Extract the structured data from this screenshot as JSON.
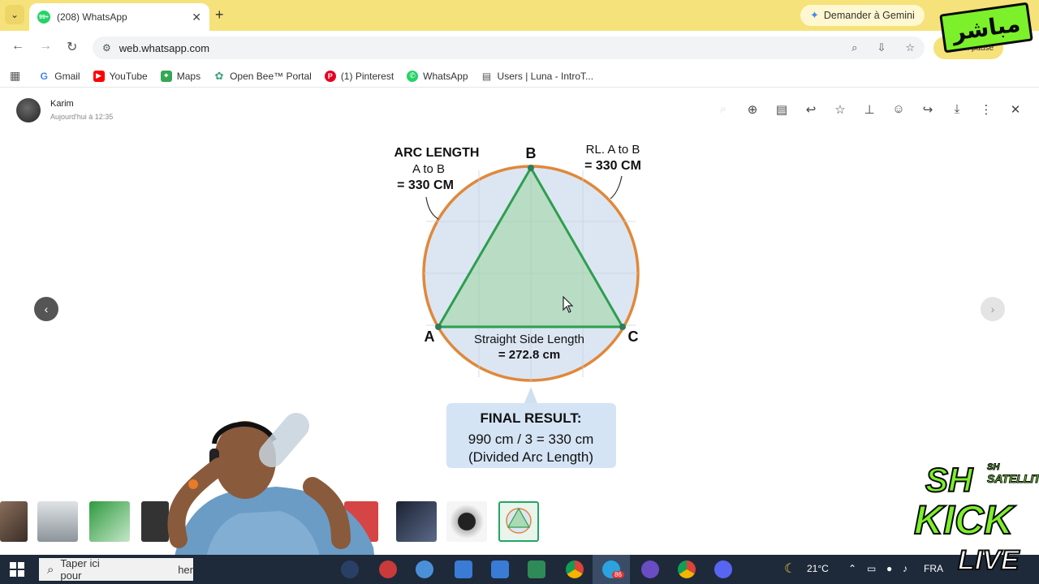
{
  "browser": {
    "tab_title": "(208) WhatsApp",
    "tab_badge": "99+",
    "gemini_label": "Demander à Gemini",
    "url": "web.whatsapp.com",
    "profile_label": "En pause"
  },
  "bookmarks": [
    {
      "label": "Gmail",
      "icon": "gmail-icon"
    },
    {
      "label": "YouTube",
      "icon": "youtube-icon"
    },
    {
      "label": "Maps",
      "icon": "maps-icon"
    },
    {
      "label": "Open Bee™ Portal",
      "icon": "openbee-icon"
    },
    {
      "label": "(1) Pinterest",
      "icon": "pinterest-icon"
    },
    {
      "label": "WhatsApp",
      "icon": "whatsapp-icon"
    },
    {
      "label": "Users | Luna - IntroT...",
      "icon": "table-icon"
    }
  ],
  "viewer": {
    "sender": "Karim",
    "time": "Aujourd'hui à 12:35"
  },
  "diagram": {
    "arc_title": "ARC LENGTH",
    "arc_sub": "A to B",
    "arc_val": "= 330 CM",
    "rl_title": "RL. A to B",
    "rl_val": "= 330 CM",
    "label_a": "A",
    "label_b": "B",
    "label_c": "C",
    "side_title": "Straight Side Length",
    "side_val": "= 272.8 cm",
    "result_title": "FINAL RESULT:",
    "result_line1": "990 cm / 3 = 330 cm",
    "result_line2": "(Divided Arc Length)"
  },
  "overlay": {
    "live_badge": "مباشر",
    "brand_sh": "SH",
    "brand_sub_sh": "SH",
    "brand_satellite": "SATELLITE",
    "brand_kick": "KICK",
    "brand_live": "LIVE"
  },
  "taskbar": {
    "search_placeholder": "Taper ici pour",
    "search_tail": "her",
    "temperature": "21°C",
    "lang": "FRA",
    "telegram_badge": "86"
  },
  "colors": {
    "tab_strip": "#f6e27a",
    "triangle": "#2e9e4f",
    "circle": "#e0883a",
    "whatsapp": "#25d366"
  }
}
